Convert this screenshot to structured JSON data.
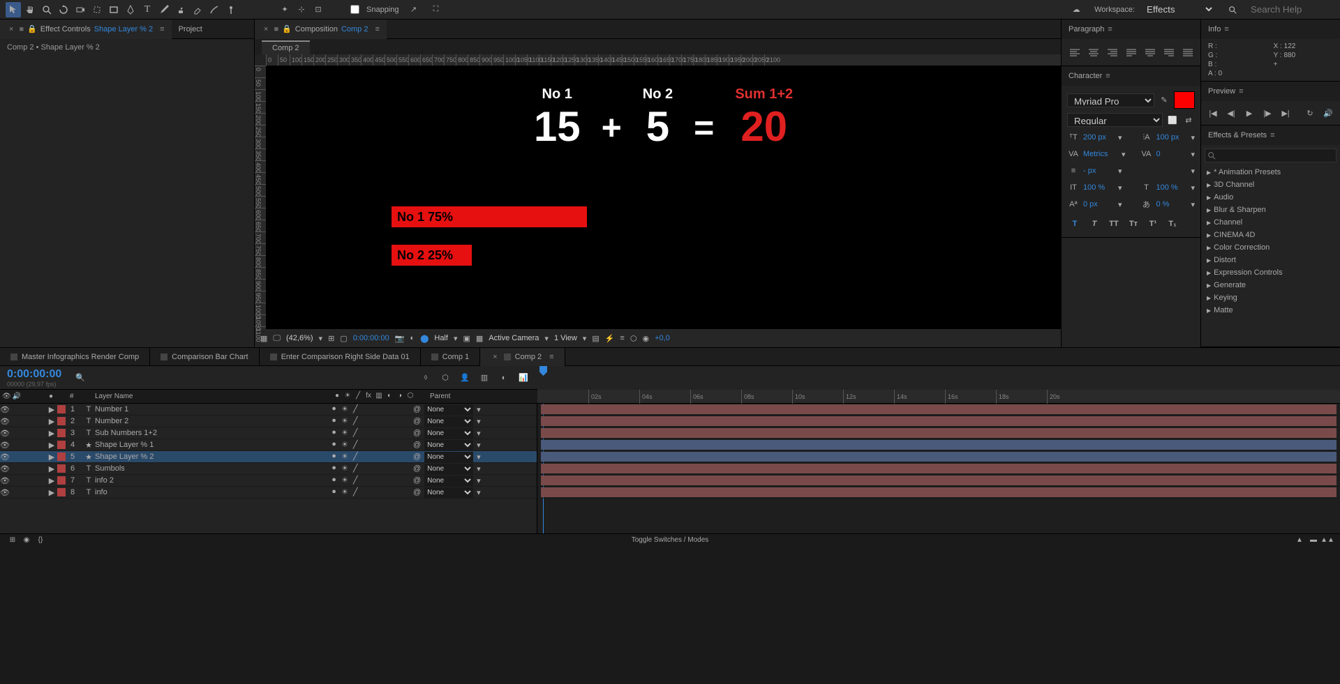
{
  "workspace": {
    "label": "Workspace:",
    "value": "Effects"
  },
  "searchHelp": "Search Help",
  "snapping": "Snapping",
  "leftPanel": {
    "effectControls": "Effect Controls",
    "effectControlsTarget": "Shape Layer % 2",
    "project": "Project",
    "breadcrumb": "Comp 2 • Shape Layer % 2"
  },
  "compPanel": {
    "title": "Composition",
    "target": "Comp 2",
    "tab": "Comp 2"
  },
  "canvas": {
    "no1Label": "No 1",
    "no1Val": "15",
    "plus": "+",
    "no2Label": "No 2",
    "no2Val": "5",
    "equals": "=",
    "sumLabel": "Sum 1+2",
    "sumVal": "20",
    "bar1": "No 1    75%",
    "bar2": "No 2    25%",
    "rulerH": [
      "0",
      "50",
      "100",
      "150",
      "200",
      "250",
      "300",
      "350",
      "400",
      "450",
      "500",
      "550",
      "600",
      "650",
      "700",
      "750",
      "800",
      "850",
      "900",
      "950",
      "1000",
      "1050",
      "1100",
      "1150",
      "1200",
      "1250",
      "1300",
      "1350",
      "1400",
      "1450",
      "1500",
      "1550",
      "1600",
      "1650",
      "1700",
      "1750",
      "1800",
      "1850",
      "1900",
      "1950",
      "2000",
      "2050",
      "2100"
    ],
    "rulerV": [
      "0",
      "50",
      "100",
      "150",
      "200",
      "250",
      "300",
      "350",
      "400",
      "450",
      "500",
      "550",
      "600",
      "650",
      "700",
      "750",
      "800",
      "850",
      "900",
      "950",
      "1000",
      "1050",
      "1100"
    ]
  },
  "compFooter": {
    "zoom": "(42,6%)",
    "time": "0:00:00:00",
    "res": "Half",
    "camera": "Active Camera",
    "view": "1 View",
    "exposure": "+0,0"
  },
  "paragraph": {
    "title": "Paragraph"
  },
  "character": {
    "title": "Character",
    "font": "Myriad Pro",
    "style": "Regular",
    "size": "200 px",
    "leading": "100 px",
    "kerning": "Metrics",
    "tracking": "0",
    "stroke": "- px",
    "vscale": "100 %",
    "hscale": "100 %",
    "baseline": "0 px",
    "tsume": "0 %"
  },
  "info": {
    "title": "Info",
    "r": "R :",
    "g": "G :",
    "b": "B :",
    "a": "A :  0",
    "x": "X : 122",
    "y": "Y :  880"
  },
  "preview": {
    "title": "Preview"
  },
  "effectsPresets": {
    "title": "Effects & Presets",
    "items": [
      "* Animation Presets",
      "3D Channel",
      "Audio",
      "Blur & Sharpen",
      "Channel",
      "CINEMA 4D",
      "Color Correction",
      "Distort",
      "Expression Controls",
      "Generate",
      "Keying",
      "Matte"
    ]
  },
  "timeline": {
    "tabs": [
      "Master Infographics Render Comp",
      "Comparison Bar Chart",
      "Enter Comparison Right Side Data 01",
      "Comp 1",
      "Comp 2"
    ],
    "activeTab": 4,
    "timecode": "0:00:00:00",
    "fps": "00000 (29,97 fps)",
    "colHead": {
      "num": "#",
      "name": "Layer Name",
      "parent": "Parent"
    },
    "parentNone": "None",
    "layers": [
      {
        "num": "1",
        "name": "Number 1",
        "type": "T",
        "color": "#b04040",
        "track": "txt"
      },
      {
        "num": "2",
        "name": "Number 2",
        "type": "T",
        "color": "#b04040",
        "track": "txt"
      },
      {
        "num": "3",
        "name": "Sub Numbers 1+2",
        "type": "T",
        "color": "#b04040",
        "track": "txt"
      },
      {
        "num": "4",
        "name": "Shape Layer % 1",
        "type": "★",
        "color": "#b04040",
        "track": "shp"
      },
      {
        "num": "5",
        "name": "Shape Layer % 2",
        "type": "★",
        "color": "#b04040",
        "track": "shp",
        "sel": true
      },
      {
        "num": "6",
        "name": "Sumbols",
        "type": "T",
        "color": "#b04040",
        "track": "txt"
      },
      {
        "num": "7",
        "name": "info 2",
        "type": "T",
        "color": "#b04040",
        "track": "txt"
      },
      {
        "num": "8",
        "name": "info",
        "type": "T",
        "color": "#b04040",
        "track": "txt"
      }
    ],
    "timeRuler": [
      "02s",
      "04s",
      "06s",
      "08s",
      "10s",
      "12s",
      "14s",
      "16s",
      "18s",
      "20s"
    ],
    "toggleSwitches": "Toggle Switches / Modes"
  }
}
